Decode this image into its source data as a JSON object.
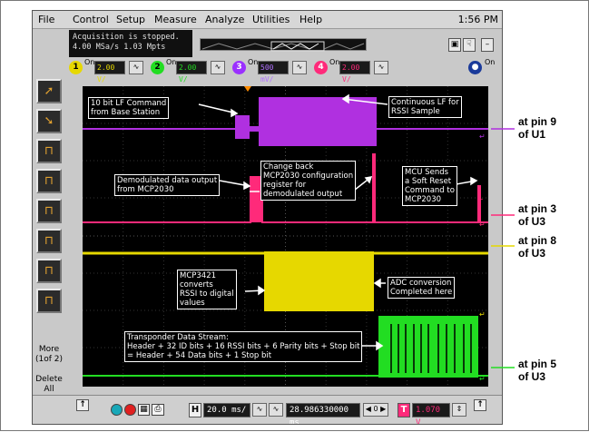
{
  "menu": {
    "items": [
      "File",
      "Control",
      "Setup",
      "Measure",
      "Analyze",
      "Utilities",
      "Help"
    ],
    "clock": "1:56 PM"
  },
  "status": {
    "line1": "Acquisition is stopped.",
    "line2": "4.00 MSa/s   1.03 Mpts"
  },
  "channels": [
    {
      "num": "1",
      "on": "On",
      "scale": "2.00 V/",
      "color": "#e6d800"
    },
    {
      "num": "2",
      "on": "On",
      "scale": "2.00 V/",
      "color": "#22dd22"
    },
    {
      "num": "3",
      "on": "On",
      "scale": "500 mV/",
      "color": "#9b30ff"
    },
    {
      "num": "4",
      "on": "On",
      "scale": "2.00 V/",
      "color": "#ff2a7a"
    }
  ],
  "math": {
    "on": "On"
  },
  "sidebar": {
    "more_label": "More",
    "more_page": "(1of 2)",
    "delete_line1": "Delete",
    "delete_line2": "All"
  },
  "callouts": {
    "lf_cmd": [
      "10 bit LF Command",
      "from Base Station"
    ],
    "cont_lf": [
      "Continuous LF for",
      "RSSI Sample"
    ],
    "demod": [
      "Demodulated data output",
      "from MCP2030"
    ],
    "change_back": [
      "Change back",
      "MCP2030 configuration",
      "register for",
      "demodulated output"
    ],
    "mcu": [
      "MCU Sends",
      "a Soft Reset",
      "Command to",
      "MCP2030"
    ],
    "mcp3421": [
      "MCP3421",
      "converts",
      "RSSI to digital",
      "values"
    ],
    "adc": [
      "ADC conversion",
      "Completed here"
    ],
    "transponder": [
      "Transponder Data Stream:",
      "Header + 32 ID bits + 16 RSSI bits + 6 Parity bits + Stop bit",
      "= Header + 54 Data bits + 1 Stop bit"
    ]
  },
  "pins": {
    "p9": [
      "at pin 9",
      "of U1"
    ],
    "p3": [
      "at pin 3",
      "of U3"
    ],
    "p8": [
      "at pin 8",
      "of U3"
    ],
    "p5": [
      "at pin 5",
      "of U3"
    ]
  },
  "marker_labels": {
    "t": "T"
  },
  "bottom": {
    "h_label": "H",
    "timebase": "20.0 ms/",
    "position": "28.986330000 ms",
    "t_label": "T",
    "trigger_level": "1.070 V"
  }
}
